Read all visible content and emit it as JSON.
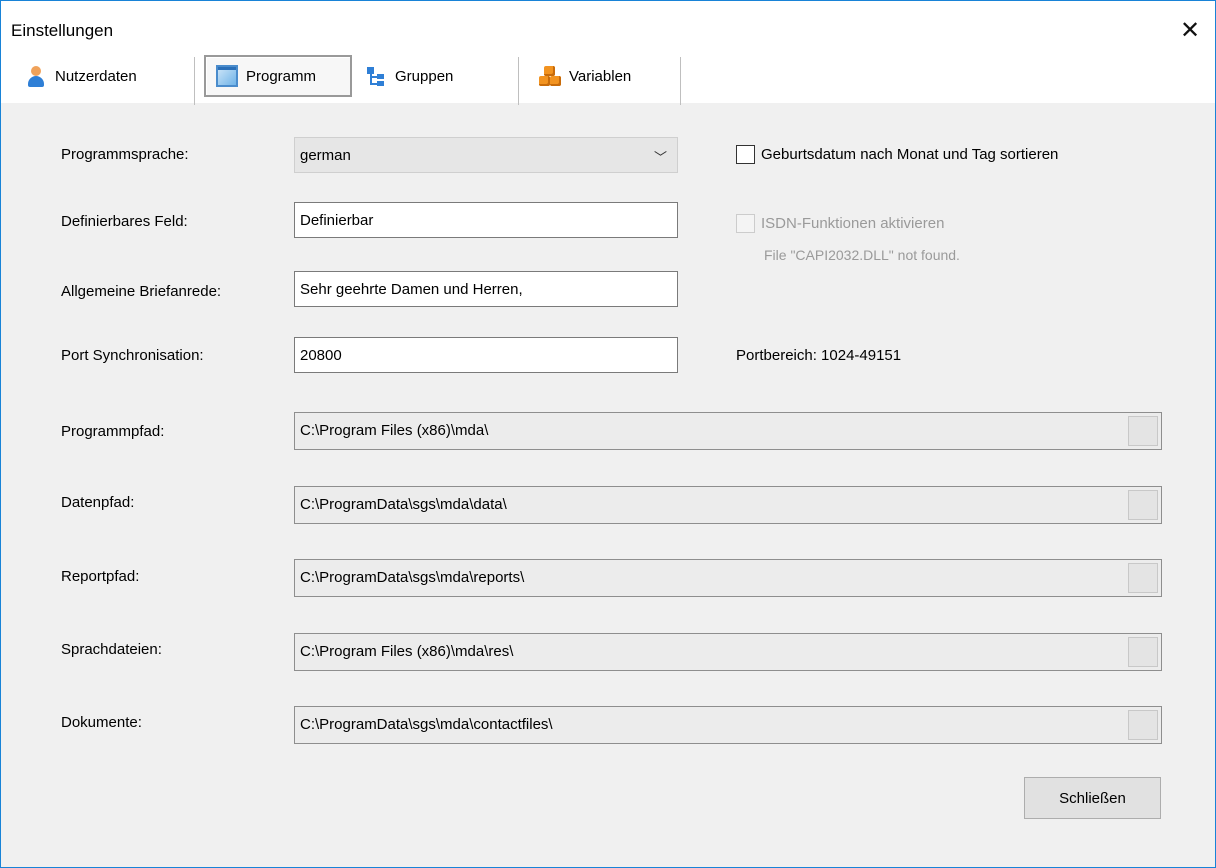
{
  "window": {
    "title": "Einstellungen"
  },
  "tabs": [
    {
      "label": "Nutzerdaten",
      "icon": "user-icon"
    },
    {
      "label": "Programm",
      "icon": "window-icon",
      "active": true
    },
    {
      "label": "Gruppen",
      "icon": "tree-icon"
    },
    {
      "label": "Variablen",
      "icon": "boxes-icon"
    }
  ],
  "form": {
    "language": {
      "label": "Programmsprache:",
      "value": "german"
    },
    "custom_field": {
      "label": "Definierbares Feld:",
      "value": "Definierbar"
    },
    "salutation": {
      "label": "Allgemeine Briefanrede:",
      "value": "Sehr geehrte Damen und Herren,"
    },
    "port": {
      "label": "Port Synchronisation:",
      "value": "20800",
      "range_info": "Portbereich: 1024-49151"
    }
  },
  "options": {
    "birthday_sort": {
      "label": "Geburtsdatum nach Monat und Tag sortieren",
      "checked": false
    },
    "isdn": {
      "label": "ISDN-Funktionen aktivieren",
      "checked": false,
      "disabled": true,
      "note": "File \"CAPI2032.DLL\" not found."
    }
  },
  "paths": [
    {
      "label": "Programmpfad:",
      "value": "C:\\Program Files (x86)\\mda\\"
    },
    {
      "label": "Datenpfad:",
      "value": "C:\\ProgramData\\sgs\\mda\\data\\"
    },
    {
      "label": "Reportpfad:",
      "value": "C:\\ProgramData\\sgs\\mda\\reports\\"
    },
    {
      "label": "Sprachdateien:",
      "value": "C:\\Program Files (x86)\\mda\\res\\"
    },
    {
      "label": "Dokumente:",
      "value": "C:\\ProgramData\\sgs\\mda\\contactfiles\\"
    }
  ],
  "buttons": {
    "close_label": "Schließen"
  },
  "colors": {
    "window_border": "#1883d7",
    "body_bg": "#f0f0f0"
  }
}
